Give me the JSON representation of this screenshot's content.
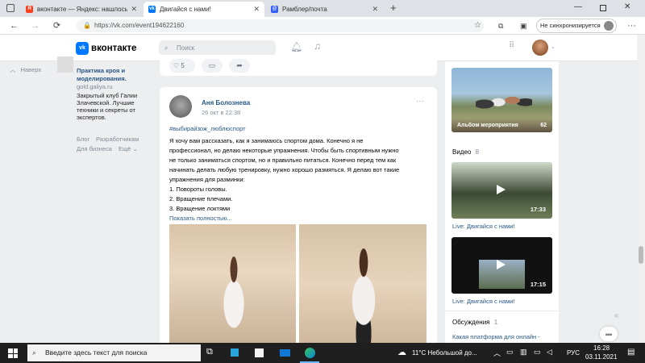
{
  "browser": {
    "tabs": [
      {
        "label": "вконтакте — Яндекс: нашлось 5",
        "favicon": "Я",
        "color": "#fc3f1d",
        "active": false
      },
      {
        "label": "Двигайся с нами!",
        "favicon": "vk",
        "color": "#0077ff",
        "active": true
      },
      {
        "label": "Рамблер/почта",
        "favicon": "@",
        "color": "#315efb",
        "active": false
      }
    ],
    "url": "https://vk.com/event194622160",
    "sync_label": "Не синхронизируется"
  },
  "vk": {
    "logo": "вконтакте",
    "search_placeholder": "Поиск",
    "up_label": "Наверх",
    "ad": {
      "title": "Практика кроя и моделирования.",
      "domain": "gold.galiya.ru",
      "text": [
        "Закрытый клуб Галии",
        "Злачевской. Лучшие",
        "техники и секреты от",
        "экспертов."
      ]
    },
    "footer": {
      "links1": [
        "Блог",
        "Разработчикам"
      ],
      "links2": [
        "Для бизнеса",
        "Ещё"
      ]
    },
    "prev_post": {
      "likes": "5"
    },
    "post": {
      "author": "Аня Болознева",
      "date": "26 окт в 22:38",
      "hashtag": "#выбирайзож_люблюспорт",
      "lines": [
        "Я хочу вам рассказать, как я занимаюсь спортом дома. Конечно я не",
        "профессионал, но делаю некоторые упражнения. Чтобы быть спортивным нужно",
        "не только заниматься спортом, но и правильно питаться. Конечно перед тем как",
        "начинать делать любую тренировку, нужно хорошо размяться. Я делаю вот такие",
        "упражнения для разминки:",
        "1. Повороты головы.",
        "2. Вращение плечами.",
        "3. Вращение локтями"
      ],
      "show_more": "Показать полностью..."
    },
    "right": {
      "album_label": "Альбом мероприятия",
      "album_count": "62",
      "video_label": "Видео",
      "video_count": "8",
      "videos": [
        {
          "duration": "17:33",
          "title": "Live: Двигайся с нами!"
        },
        {
          "duration": "17:15",
          "title": "Live: Двигайся с нами!"
        }
      ],
      "discussions_label": "Обсуждения",
      "discussions_count": "1",
      "discussion_title": "Какая платформа для онлайн -"
    }
  },
  "taskbar": {
    "search_placeholder": "Введите здесь текст для поиска",
    "weather": "11°C  Небольшой до...",
    "lang": "РУС",
    "time": "16:28",
    "date": "03.11.2021"
  }
}
